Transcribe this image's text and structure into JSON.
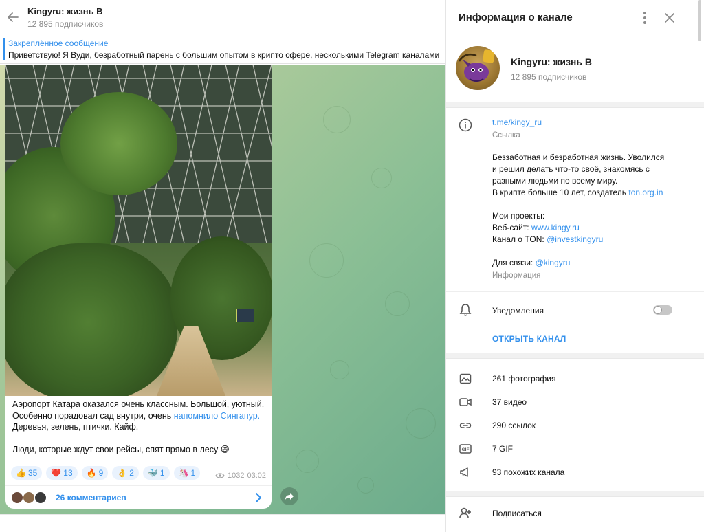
{
  "chat": {
    "title": "Kingyru: жизнь В",
    "subscribers": "12 895 подписчиков",
    "pinned": {
      "title": "Закреплённое сообщение",
      "text": "Приветствую! Я Вуди, безработный парень с большим опытом в крипто сфере, несколькими Telegram каналами"
    },
    "message": {
      "lines": [
        "Аэропорт Катара оказался очень классным. Большой, уютный.",
        "Особенно порадовал сад внутри, очень ",
        "Деревья, зелень, птички. Кайф.",
        "Люди, которые ждут свои рейсы, спят прямо в лесу 😄"
      ],
      "link_text": "напомнило Сингапур.",
      "reactions": [
        {
          "emoji": "👍",
          "count": "35"
        },
        {
          "emoji": "❤️",
          "count": "13"
        },
        {
          "emoji": "🔥",
          "count": "9"
        },
        {
          "emoji": "👌",
          "count": "2"
        },
        {
          "emoji": "🐳",
          "count": "1"
        },
        {
          "emoji": "🦄",
          "count": "1"
        }
      ],
      "views": "1032",
      "time": "03:02",
      "comments": "26 комментариев"
    }
  },
  "panel": {
    "title": "Информация о канале",
    "channel_name": "Kingyru: жизнь В",
    "subscribers": "12 895 подписчиков",
    "link": "t.me/kingy_ru",
    "link_label": "Ссылка",
    "description": {
      "l1": "Беззаботная и безработная жизнь. Уволился",
      "l2": "и решил делать что-то своё, знакомясь с",
      "l3": "разными людьми по всему миру.",
      "l4": "В крипте больше 10 лет, создатель ",
      "l4_link": "ton.org.in",
      "l5": "Мои проекты:",
      "l6": "Веб-сайт: ",
      "l6_link": "www.kingy.ru",
      "l7": "Канал о TON: ",
      "l7_link": "@investkingyru",
      "l8": "Для связи: ",
      "l8_link": "@kingyru"
    },
    "info_label": "Информация",
    "notifications": "Уведомления",
    "notifications_on": false,
    "open_channel": "ОТКРЫТЬ КАНАЛ",
    "media": [
      {
        "icon": "photo-icon",
        "label": "261 фотография"
      },
      {
        "icon": "video-icon",
        "label": "37 видео"
      },
      {
        "icon": "link-icon",
        "label": "290 ссылок"
      },
      {
        "icon": "gif-icon",
        "label": "7 GIF"
      },
      {
        "icon": "megaphone-icon",
        "label": "93 похожих канала"
      }
    ],
    "subscribe": "Подписаться"
  },
  "colors": {
    "accent": "#3390ec",
    "muted": "#8a8a8a"
  }
}
